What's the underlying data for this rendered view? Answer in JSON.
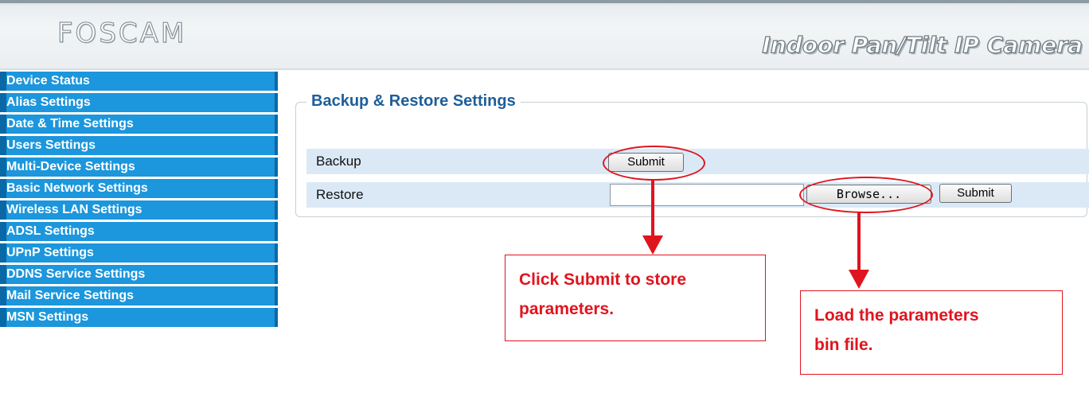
{
  "header": {
    "logo": "FOSCAM",
    "product": "Indoor Pan/Tilt IP Camera"
  },
  "sidebar": {
    "items": [
      {
        "label": "Device Status"
      },
      {
        "label": "Alias Settings"
      },
      {
        "label": "Date & Time Settings"
      },
      {
        "label": "Users Settings"
      },
      {
        "label": "Multi-Device Settings"
      },
      {
        "label": "Basic Network Settings"
      },
      {
        "label": "Wireless LAN Settings"
      },
      {
        "label": "ADSL Settings"
      },
      {
        "label": "UPnP Settings"
      },
      {
        "label": "DDNS Service Settings"
      },
      {
        "label": "Mail Service Settings"
      },
      {
        "label": "MSN Settings"
      }
    ]
  },
  "panel": {
    "title": "Backup & Restore Settings",
    "backup": {
      "label": "Backup",
      "submit_label": "Submit"
    },
    "restore": {
      "label": "Restore",
      "file_value": "",
      "browse_label": "Browse...",
      "submit_label": "Submit"
    }
  },
  "annotations": {
    "callout_submit": [
      "Click Submit to store",
      "parameters."
    ],
    "callout_browse": [
      "Load the parameters",
      "bin file."
    ]
  },
  "colors": {
    "nav_bg": "#1c96dc",
    "nav_border": "#0a68a6",
    "row_bg": "#dbe9f7",
    "title": "#1d5e9a",
    "annotation": "#e0141e"
  }
}
